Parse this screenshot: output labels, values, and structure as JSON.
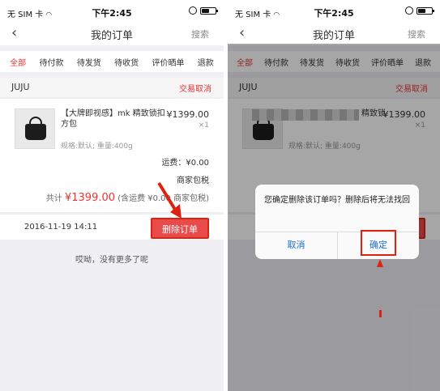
{
  "status_bar": {
    "carrier": "无 SIM 卡",
    "time": "下午2:45",
    "battery_level": 0.55
  },
  "nav": {
    "title": "我的订单",
    "search_label": "搜索"
  },
  "tabs": [
    {
      "label": "全部",
      "active": true
    },
    {
      "label": "待付款",
      "active": false
    },
    {
      "label": "待发货",
      "active": false
    },
    {
      "label": "待收货",
      "active": false
    },
    {
      "label": "评价晒单",
      "active": false
    },
    {
      "label": "退款",
      "active": false
    }
  ],
  "order": {
    "shop_name": "JUJU",
    "status": "交易取消",
    "product_title": "【大牌即视感】mk 精致锁扣方包",
    "right_product_title": "精致锁",
    "price": "¥1399.00",
    "quantity": "×1",
    "spec": "规格:默认; 重量:400g",
    "shipping_label": "运费：",
    "shipping_value": "¥0.00",
    "shipping_note": "商家包税",
    "total_label": "共计",
    "total_amount": "¥1399.00",
    "total_note": "(含运费 ¥0.00 商家包税)",
    "date": "2016-11-19 14:11",
    "delete_label": "删除订单"
  },
  "no_more_text": "哎呦，没有更多了呢",
  "dialog": {
    "message": "您确定删除该订单吗？删除后将无法找回",
    "cancel_label": "取消",
    "confirm_label": "确定"
  },
  "colors": {
    "accent": "#e33333",
    "dialog_button": "#1a6fe0",
    "highlight": "#dd2211"
  }
}
